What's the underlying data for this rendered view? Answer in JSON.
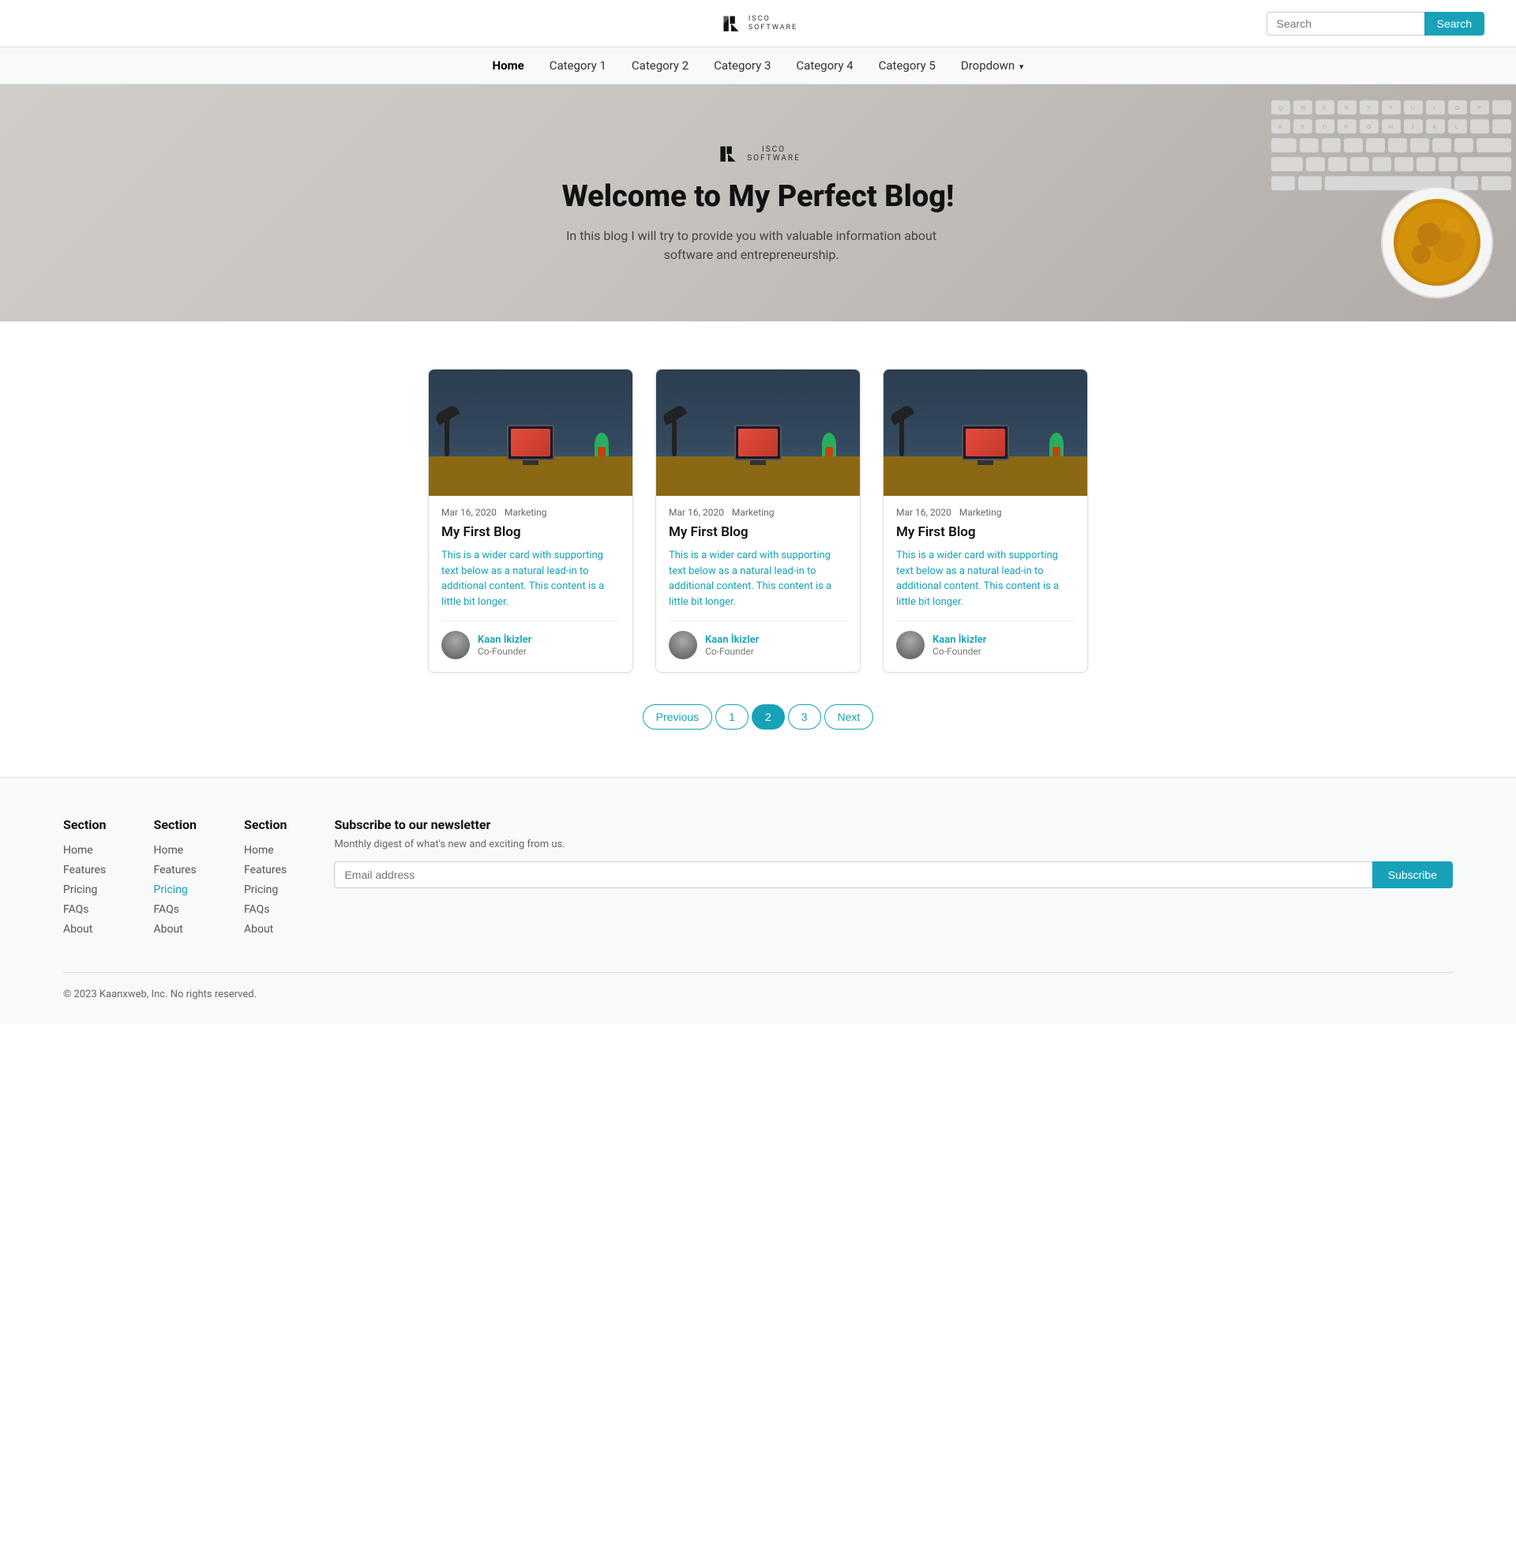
{
  "header": {
    "logo_name": "ISCO",
    "logo_subtitle": "SOFTWARE",
    "search_placeholder": "Search",
    "search_button": "Search"
  },
  "nav": {
    "items": [
      {
        "label": "Home",
        "active": true
      },
      {
        "label": "Category 1",
        "active": false
      },
      {
        "label": "Category 2",
        "active": false
      },
      {
        "label": "Category 3",
        "active": false
      },
      {
        "label": "Category 4",
        "active": false
      },
      {
        "label": "Category 5",
        "active": false
      },
      {
        "label": "Dropdown",
        "active": false,
        "has_dropdown": true
      }
    ]
  },
  "hero": {
    "logo_name": "ISCO",
    "logo_subtitle": "SOFTWARE",
    "title": "Welcome to My Perfect Blog!",
    "description": "In this blog I will try to provide you with valuable information about software and entrepreneurship."
  },
  "cards": [
    {
      "date": "Mar 16, 2020",
      "category": "Marketing",
      "title": "My First Blog",
      "text": "This is a wider card with supporting text below as a natural lead-in to additional content. This content is a little bit longer.",
      "author_name": "Kaan İkizler",
      "author_role": "Co-Founder"
    },
    {
      "date": "Mar 16, 2020",
      "category": "Marketing",
      "title": "My First Blog",
      "text": "This is a wider card with supporting text below as a natural lead-in to additional content. This content is a little bit longer.",
      "author_name": "Kaan İkizler",
      "author_role": "Co-Founder"
    },
    {
      "date": "Mar 16, 2020",
      "category": "Marketing",
      "title": "My First Blog",
      "text": "This is a wider card with supporting text below as a natural lead-in to additional content. This content is a little bit longer.",
      "author_name": "Kaan İkizler",
      "author_role": "Co-Founder"
    }
  ],
  "pagination": {
    "previous": "Previous",
    "next": "Next",
    "pages": [
      "1",
      "2",
      "3"
    ],
    "active_page": "2"
  },
  "footer": {
    "columns": [
      {
        "title": "Section",
        "links": [
          {
            "label": "Home",
            "active": false
          },
          {
            "label": "Features",
            "active": false
          },
          {
            "label": "Pricing",
            "active": false
          },
          {
            "label": "FAQs",
            "active": false
          },
          {
            "label": "About",
            "active": false
          }
        ]
      },
      {
        "title": "Section",
        "links": [
          {
            "label": "Home",
            "active": false
          },
          {
            "label": "Features",
            "active": false
          },
          {
            "label": "Pricing",
            "active": true
          },
          {
            "label": "FAQs",
            "active": false
          },
          {
            "label": "About",
            "active": false
          }
        ]
      },
      {
        "title": "Section",
        "links": [
          {
            "label": "Home",
            "active": false
          },
          {
            "label": "Features",
            "active": false
          },
          {
            "label": "Pricing",
            "active": false
          },
          {
            "label": "FAQs",
            "active": false
          },
          {
            "label": "About",
            "active": false
          }
        ]
      }
    ],
    "newsletter": {
      "title": "Subscribe to our newsletter",
      "description": "Monthly digest of what's new and exciting from us.",
      "input_placeholder": "Email address",
      "button_label": "Subscribe"
    },
    "copyright": "© 2023 Kaanxweb, Inc. No rights reserved."
  }
}
